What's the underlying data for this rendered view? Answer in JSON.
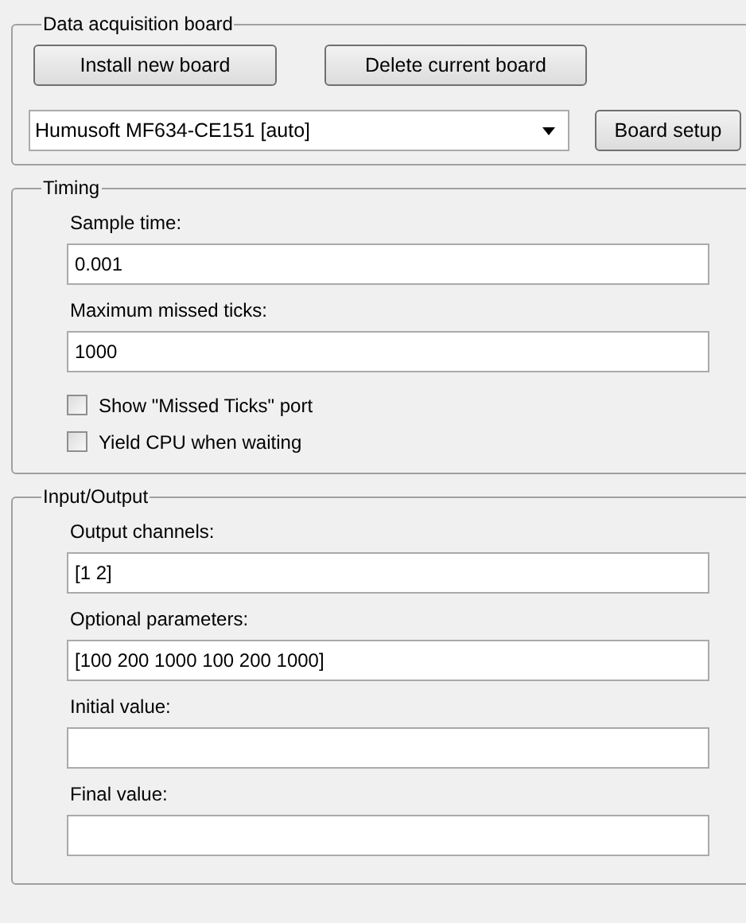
{
  "groups": [
    {
      "title": "Data acquisition board",
      "items": [
        {
          "kind": "buttons",
          "buttons": [
            "Install new board",
            "Delete current board"
          ]
        },
        {
          "kind": "dropdown",
          "value": "Humusoft MF634-CE151 [auto]",
          "button": "Board setup"
        }
      ]
    },
    {
      "title": "Timing",
      "items": [
        {
          "kind": "field",
          "label": "Sample time:",
          "value": "0.001"
        },
        {
          "kind": "field",
          "label": "Maximum missed ticks:",
          "value": "1000"
        },
        {
          "kind": "checkbox",
          "label": "Show \"Missed Ticks\" port",
          "checked": false
        },
        {
          "kind": "checkbox",
          "label": "Yield CPU when waiting",
          "checked": false
        }
      ]
    },
    {
      "title": "Input/Output",
      "items": [
        {
          "kind": "field",
          "label": "Output channels:",
          "value": "[1 2]"
        },
        {
          "kind": "field",
          "label": "Optional parameters:",
          "value": "[100 200 1000 100 200 1000]"
        },
        {
          "kind": "field",
          "label": "Initial value:",
          "value": ""
        },
        {
          "kind": "field",
          "label": "Final value:",
          "value": ""
        }
      ]
    }
  ]
}
